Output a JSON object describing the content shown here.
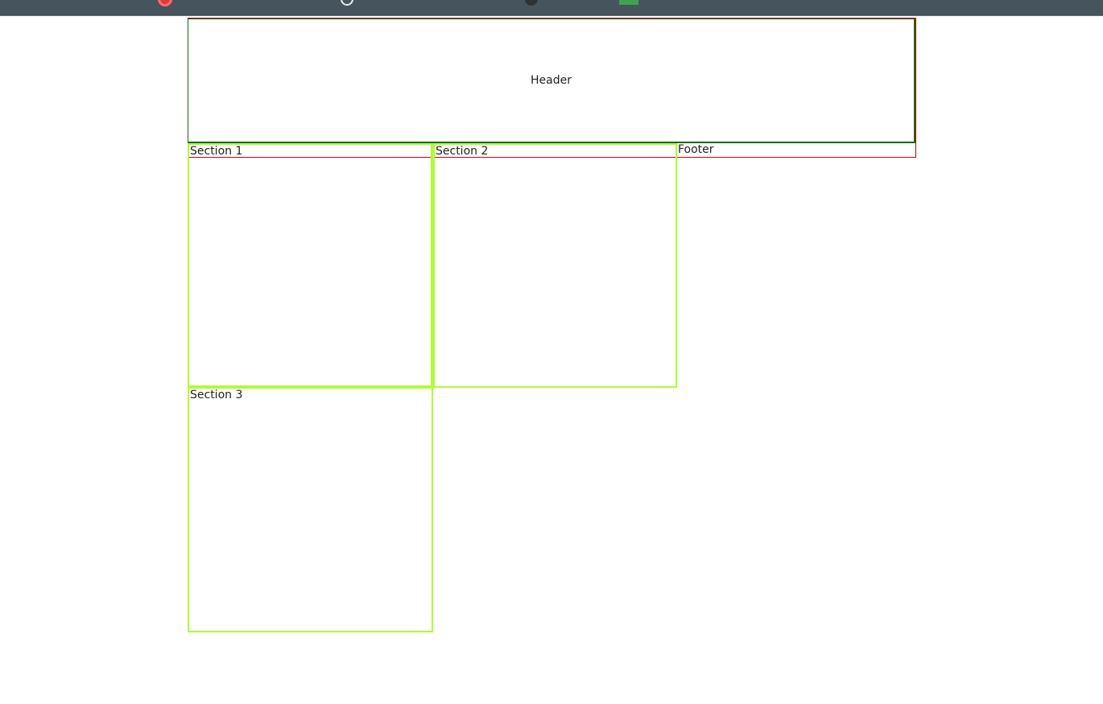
{
  "layout": {
    "header": {
      "label": "Header"
    },
    "sections": [
      {
        "label": "Section 1"
      },
      {
        "label": "Section 2"
      },
      {
        "label": "Section 3"
      }
    ],
    "footer": {
      "label": "Footer"
    }
  },
  "colors": {
    "bookmarks_bar": "#46545e",
    "wrapper_border": "#cc0000",
    "header_border": "#0a6b0a",
    "section_border": "#adff2f"
  }
}
